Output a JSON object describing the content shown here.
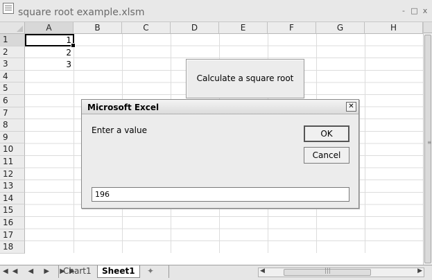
{
  "window": {
    "title": "square root example.xlsm",
    "controls": [
      "-",
      "□",
      "x"
    ]
  },
  "sheet": {
    "columns": [
      "A",
      "B",
      "C",
      "D",
      "E",
      "F",
      "G",
      "H"
    ],
    "rows": [
      "1",
      "2",
      "3",
      "4",
      "5",
      "6",
      "7",
      "8",
      "9",
      "10",
      "11",
      "12",
      "13",
      "14",
      "15",
      "16",
      "17",
      "18"
    ],
    "cells": {
      "A1": "1",
      "A2": "2",
      "A3": "3"
    }
  },
  "sheet_button": {
    "label": "Calculate a square root"
  },
  "dialog": {
    "title": "Microsoft Excel",
    "prompt": "Enter a value",
    "ok_label": "OK",
    "cancel_label": "Cancel",
    "input_value": "196"
  },
  "tabs": {
    "nav": "◀◀ ◀ ▶ ▶▶",
    "items": [
      "Chart1",
      "Sheet1"
    ],
    "active": "Sheet1"
  },
  "scrollbar": {
    "grip": "|||"
  }
}
